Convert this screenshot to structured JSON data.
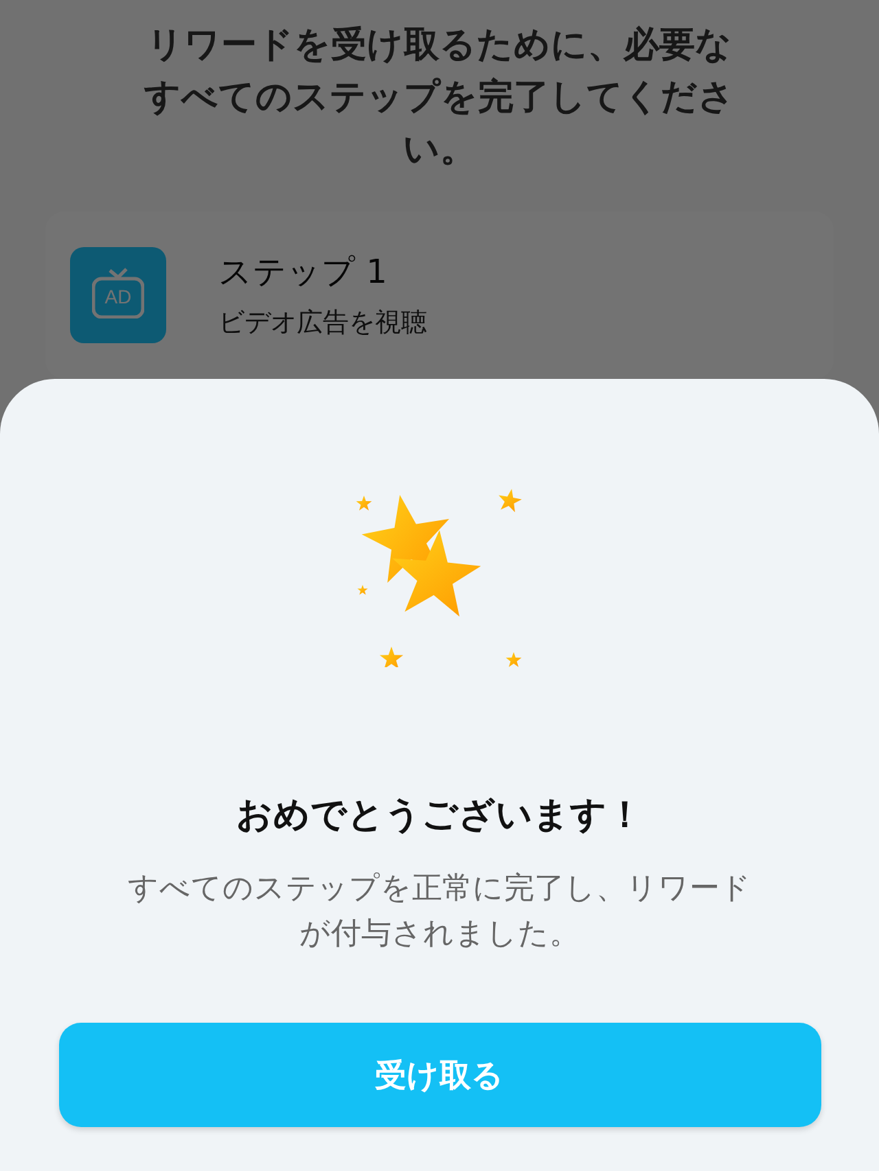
{
  "background": {
    "instruction": "リワードを受け取るために、必要なすべてのステップを完了してください。",
    "steps": [
      {
        "title": "ステップ 1",
        "description": "ビデオ広告を視聴",
        "kind": "ad",
        "icon_label": "AD"
      }
    ]
  },
  "dialog": {
    "title": "おめでとうございます！",
    "message": "すべてのステップを正常に完了し、リワードが付与されました。",
    "button": "受け取る"
  }
}
